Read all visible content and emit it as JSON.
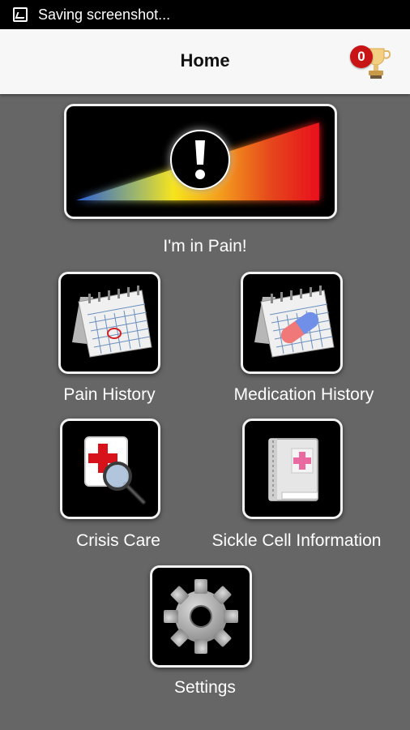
{
  "status_bar": {
    "text": "Saving screenshot..."
  },
  "app_bar": {
    "title": "Home",
    "trophy_count": "0"
  },
  "pain_button": {
    "label": "I'm in Pain!",
    "icon": "pain-scale-alert-icon"
  },
  "menu": {
    "pain_history": {
      "label": "Pain History",
      "icon": "calendar-circled-icon"
    },
    "medication_history": {
      "label": "Medication History",
      "icon": "calendar-pill-icon"
    },
    "crisis_care": {
      "label": "Crisis Care",
      "icon": "medical-magnifier-icon"
    },
    "sickle_cell_information": {
      "label": "Sickle Cell Information",
      "icon": "medical-book-icon"
    },
    "settings": {
      "label": "Settings",
      "icon": "gear-icon"
    }
  },
  "colors": {
    "background": "#666666",
    "app_bar": "#f7f7f7",
    "badge": "#c81414",
    "tile": "#000000"
  }
}
